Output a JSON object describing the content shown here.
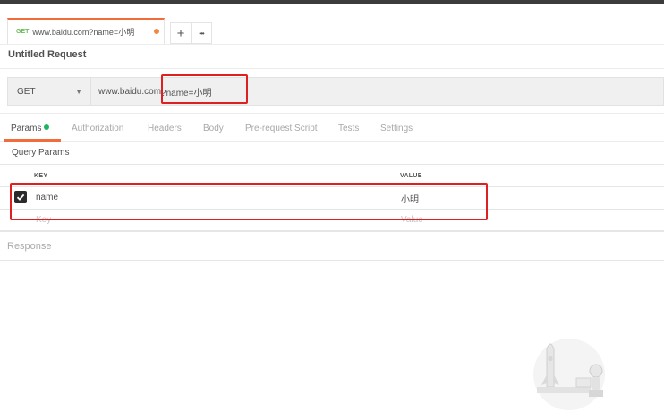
{
  "tab": {
    "method": "GET",
    "url": "www.baidu.com?name=小明"
  },
  "tab_actions": {
    "new": "+",
    "more": "•••"
  },
  "request": {
    "title": "Untitled Request",
    "method": "GET",
    "url_prefix": "www.baidu.com",
    "url_query": "?name=小明"
  },
  "subtabs": [
    "Params",
    "Authorization",
    "Headers",
    "Body",
    "Pre-request Script",
    "Tests",
    "Settings"
  ],
  "params": {
    "section_label": "Query Params",
    "headers": {
      "key": "KEY",
      "value": "VALUE"
    },
    "rows": [
      {
        "key": "name",
        "value": "小明",
        "checked": true
      }
    ],
    "new_row": {
      "key_placeholder": "Key",
      "value_placeholder": "Value"
    }
  },
  "response": {
    "label": "Response"
  },
  "colors": {
    "accent": "#f26b3a",
    "active_dot": "#24b262",
    "highlight": "#e02020",
    "get_method": "#6bbd5b"
  }
}
